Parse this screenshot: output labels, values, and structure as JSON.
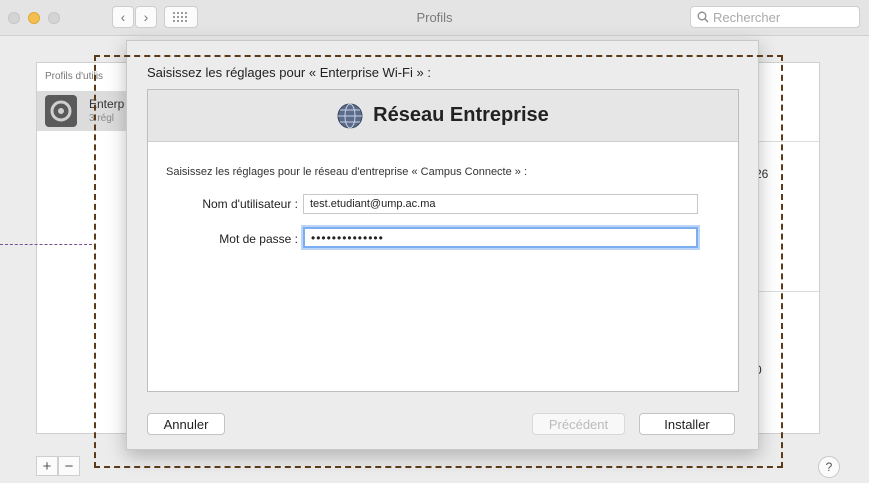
{
  "window": {
    "title": "Profils",
    "search_placeholder": "Rechercher"
  },
  "sidebar": {
    "title": "Profils d'utilis",
    "profile_name": "Enterp",
    "profile_sub": "3 régl"
  },
  "detail": {
    "value_1": "26",
    "value_2": "0"
  },
  "bottom": {
    "add": "+",
    "remove": "−",
    "help": "?"
  },
  "sheet": {
    "heading": "Saisissez les réglages pour « Enterprise Wi-Fi » :",
    "panel_title": "Réseau Entreprise",
    "description": "Saisissez les réglages pour le réseau d'entreprise « Campus Connecte » :",
    "username_label": "Nom d'utilisateur :",
    "username_value": "test.etudiant@ump.ac.ma",
    "password_label": "Mot de passe :",
    "password_value": "••••••••••••••",
    "cancel_label": "Annuler",
    "previous_label": "Précédent",
    "install_label": "Installer"
  }
}
